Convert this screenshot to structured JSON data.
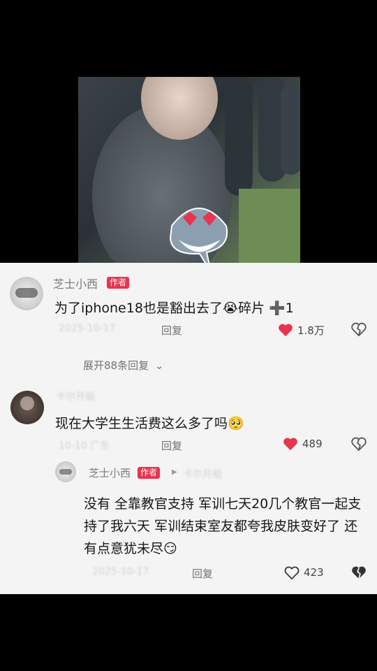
{
  "comments": [
    {
      "username": "芝士小西",
      "badge": "作者",
      "text": "为了iphone18也是豁出去了😭碎片 ➕1",
      "date": "2025-10-17",
      "reply_label": "回复",
      "likes": "1.8万",
      "expand_label": "展开88条回复"
    },
    {
      "username": "卡尔开船",
      "text": "现在大学生生活费这么多了吗🥺",
      "date": "10-10 广东",
      "reply_label": "回复",
      "likes": "489"
    },
    {
      "username": "芝士小西",
      "badge": "作者",
      "reply_to": "卡尔开船",
      "text": "没有 全靠教官支持 军训七天20几个教官一起支持了我六天 军训结束室友都夸我皮肤变好了 还有点意犹未尽😏",
      "date": "2025-10-17",
      "reply_label": "回复",
      "likes": "423"
    }
  ],
  "colors": {
    "like_red": "#e8344e",
    "badge_red": "#e8344e",
    "panel_bg": "#f4f4f4"
  }
}
